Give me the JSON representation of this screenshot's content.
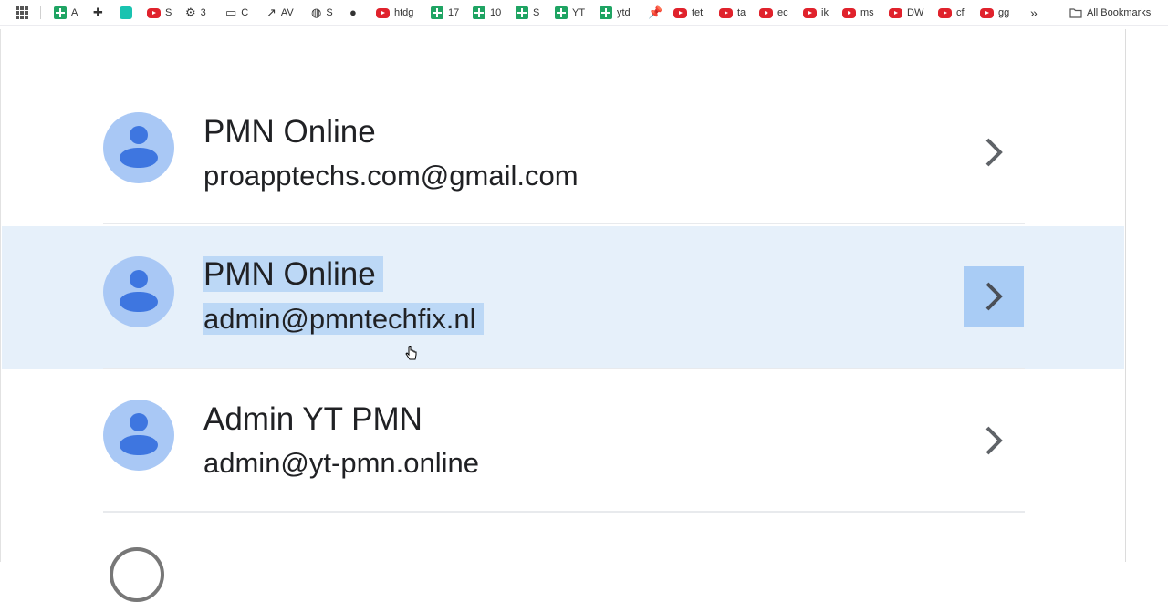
{
  "bookmarks_bar": {
    "items": [
      {
        "icon": "sheets-icon",
        "label": "A"
      },
      {
        "icon": "extension-icon",
        "label": ""
      },
      {
        "icon": "canva-icon",
        "label": ""
      },
      {
        "icon": "youtube-icon",
        "label": "S"
      },
      {
        "icon": "chatgpt-icon",
        "label": "3"
      },
      {
        "icon": "folder-icon",
        "label": "C"
      },
      {
        "icon": "analytics-icon",
        "label": "AV"
      },
      {
        "icon": "globe-icon",
        "label": "S"
      },
      {
        "icon": "github-icon",
        "label": ""
      },
      {
        "icon": "youtube-icon",
        "label": "htdg"
      },
      {
        "icon": "sheets-icon",
        "label": "17"
      },
      {
        "icon": "sheets-icon",
        "label": "10"
      },
      {
        "icon": "sheets-icon",
        "label": "S"
      },
      {
        "icon": "sheets-icon",
        "label": "YT"
      },
      {
        "icon": "sheets-icon",
        "label": "ytd"
      },
      {
        "icon": "pin-icon",
        "label": ""
      },
      {
        "icon": "youtube-icon",
        "label": "tet"
      },
      {
        "icon": "youtube-icon",
        "label": "ta"
      },
      {
        "icon": "youtube-icon",
        "label": "ec"
      },
      {
        "icon": "youtube-icon",
        "label": "ik"
      },
      {
        "icon": "youtube-icon",
        "label": "ms"
      },
      {
        "icon": "youtube-icon",
        "label": "DW"
      },
      {
        "icon": "youtube-icon",
        "label": "cf"
      },
      {
        "icon": "youtube-icon",
        "label": "gg"
      }
    ],
    "overflow_label": "»",
    "all_bookmarks_label": "All Bookmarks"
  },
  "accounts": [
    {
      "name": "PMN Online",
      "email": "proapptechs.com@gmail.com",
      "selected": false
    },
    {
      "name": "PMN Online",
      "email": "admin@pmntechfix.nl",
      "selected": true
    },
    {
      "name": "Admin YT PMN",
      "email": "admin@yt-pmn.online",
      "selected": false
    }
  ],
  "colors": {
    "selected_row": "#e6f0fa",
    "text_highlight": "#bcd8f6",
    "avatar_bg": "#a9c8f5",
    "avatar_fg": "#3e76e0"
  }
}
